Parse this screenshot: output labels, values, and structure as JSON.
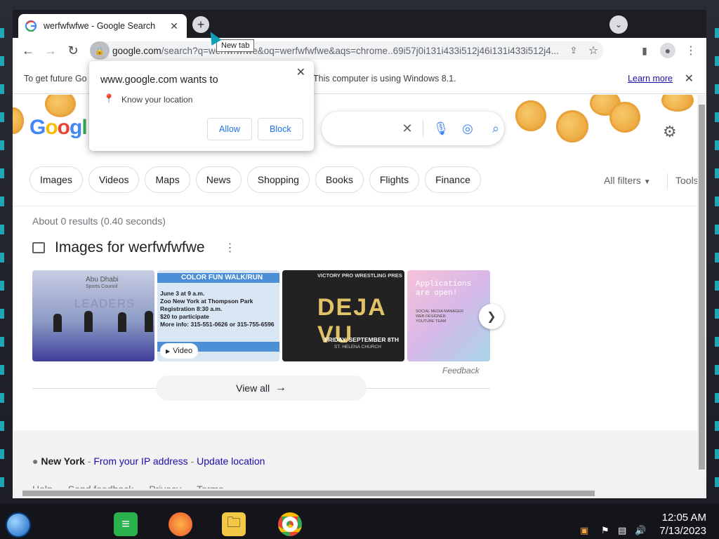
{
  "browser": {
    "tab_title": "werfwfwfwe - Google Search",
    "new_tab_tooltip": "New tab",
    "url_host": "google.com",
    "url_rest": "/search?q=werfwfwfwe&oq=werfwfwfwe&aqs=chrome..69i57j0i131i433i512j46i131i433i512j4..."
  },
  "infobar": {
    "text_left": "To get future Go",
    "text_right": "This computer is using Windows 8.1.",
    "learn_more": "Learn more"
  },
  "permission_popup": {
    "heading": "www.google.com wants to",
    "permission": "Know your location",
    "allow": "Allow",
    "block": "Block"
  },
  "search": {
    "filters": [
      "Images",
      "Videos",
      "Maps",
      "News",
      "Shopping",
      "Books",
      "Flights",
      "Finance"
    ],
    "all_filters": "All filters",
    "tools": "Tools",
    "results_count": "About 0 results (0.40 seconds)",
    "images_heading": "Images for werfwfwfwe",
    "video_badge": "Video",
    "feedback": "Feedback",
    "view_all": "View all"
  },
  "thumbnails": {
    "t1": {
      "line1": "Abu Dhabi",
      "line2": "Sports Council",
      "line3": "LEADERS"
    },
    "t2": {
      "title": "COLOR FUN WALK/RUN",
      "lines": [
        "June 3 at 9 a.m.",
        "Zoo New York at Thompson Park",
        "Registration 8:30 a.m.",
        "$20 to participate",
        "More info: 315-551-0626 or 315-755-6596"
      ]
    },
    "t3": {
      "header": "VICTORY PRO WRESTLING PRES",
      "title": "DEJA VU",
      "date": "FRIDAY, SEPTEMBER 8TH",
      "place": "ST. HELENA CHURCH"
    },
    "t4": {
      "title": "Applications are open!",
      "lines": [
        "SOCIAL MEDIA MANAGER",
        "WEB DESIGNER",
        "YOUTUBE TEAM"
      ]
    }
  },
  "footer": {
    "location_name": "New York",
    "from_ip": "From your IP address",
    "update": "Update location",
    "links": [
      "Help",
      "Send feedback",
      "Privacy",
      "Terms"
    ]
  },
  "taskbar": {
    "time": "12:05 AM",
    "date": "7/13/2023"
  },
  "colors": {
    "link": "#1a0dab",
    "accent_blue": "#1a73e8",
    "tab_strip": "#1d1e24"
  }
}
